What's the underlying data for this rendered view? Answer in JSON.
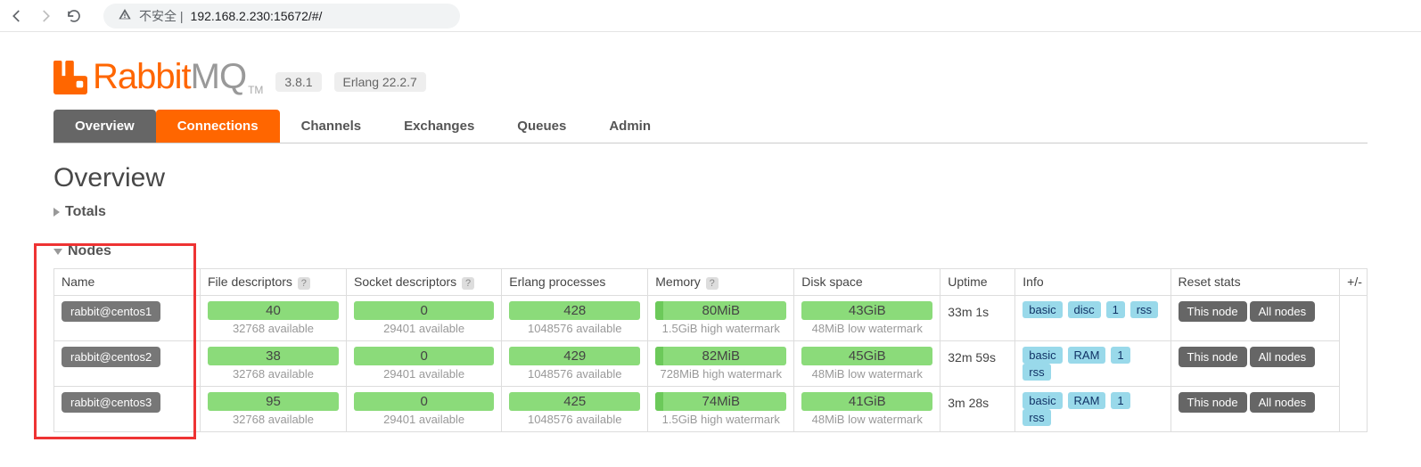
{
  "browser": {
    "url_prefix": "不安全 | ",
    "url": "192.168.2.230:15672/#/"
  },
  "logo": {
    "text1": "Rabbit",
    "text2": "MQ",
    "tm": "TM"
  },
  "version_badge": "3.8.1",
  "erlang_badge": "Erlang 22.2.7",
  "tabs": {
    "overview": "Overview",
    "connections": "Connections",
    "channels": "Channels",
    "exchanges": "Exchanges",
    "queues": "Queues",
    "admin": "Admin"
  },
  "page_title": "Overview",
  "section_totals": "Totals",
  "section_nodes": "Nodes",
  "nodes_table": {
    "headers": {
      "name": "Name",
      "fd": "File descriptors",
      "sd": "Socket descriptors",
      "ep": "Erlang processes",
      "mem": "Memory",
      "disk": "Disk space",
      "uptime": "Uptime",
      "info": "Info",
      "reset": "Reset stats",
      "pm": "+/-"
    },
    "subs": {
      "fd": "32768 available",
      "sd": "29401 available",
      "ep": "1048576 available"
    },
    "rows": [
      {
        "name": "rabbit@centos1",
        "fd": "40",
        "sd": "0",
        "ep": "428",
        "mem": "80MiB",
        "mem_sub": "1.5GiB high watermark",
        "disk": "43GiB",
        "disk_sub": "48MiB low watermark",
        "uptime": "33m 1s",
        "info": [
          "basic",
          "disc",
          "1",
          "rss"
        ]
      },
      {
        "name": "rabbit@centos2",
        "fd": "38",
        "sd": "0",
        "ep": "429",
        "mem": "82MiB",
        "mem_sub": "728MiB high watermark",
        "disk": "45GiB",
        "disk_sub": "48MiB low watermark",
        "uptime": "32m 59s",
        "info": [
          "basic",
          "RAM",
          "1",
          "rss"
        ]
      },
      {
        "name": "rabbit@centos3",
        "fd": "95",
        "sd": "0",
        "ep": "425",
        "mem": "74MiB",
        "mem_sub": "1.5GiB high watermark",
        "disk": "41GiB",
        "disk_sub": "48MiB low watermark",
        "uptime": "3m 28s",
        "info": [
          "basic",
          "RAM",
          "1",
          "rss"
        ]
      }
    ],
    "reset_buttons": {
      "this": "This node",
      "all": "All nodes"
    }
  }
}
